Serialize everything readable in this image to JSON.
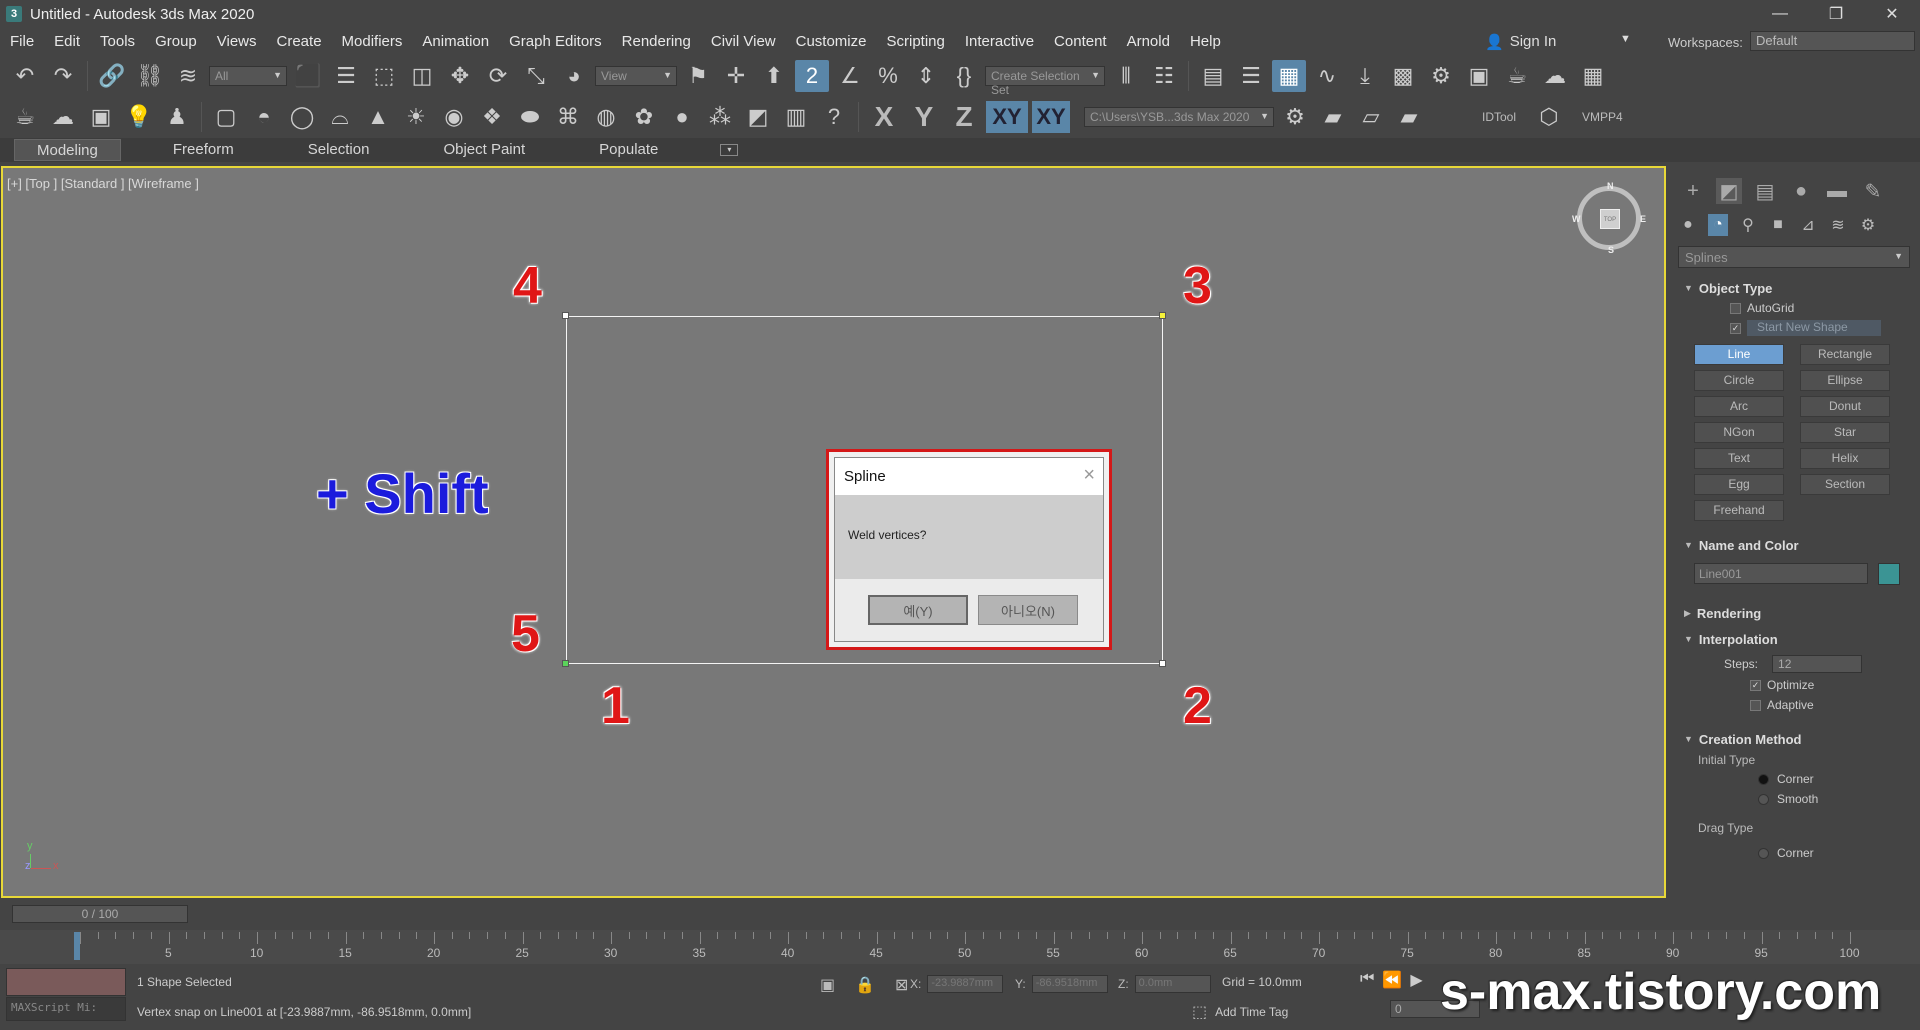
{
  "window": {
    "title": "Untitled - Autodesk 3ds Max 2020",
    "app_icon": "3"
  },
  "menu": [
    "File",
    "Edit",
    "Tools",
    "Group",
    "Views",
    "Create",
    "Modifiers",
    "Animation",
    "Graph Editors",
    "Rendering",
    "Civil View",
    "Customize",
    "Scripting",
    "Interactive",
    "Content",
    "Arnold",
    "Help"
  ],
  "account": {
    "sign_in": "Sign In",
    "workspaces_label": "Workspaces:",
    "workspace_value": "Default"
  },
  "toolbar1": {
    "filter_value": "All",
    "ref_coord_value": "View",
    "selection_set_placeholder": "Create Selection Set"
  },
  "toolbar2": {
    "axes": [
      "X",
      "Y",
      "Z",
      "XY",
      "XY"
    ],
    "project_path": "C:\\Users\\YSB...3ds Max 2020",
    "idtool": "IDTool",
    "vmpp": "VMPP4"
  },
  "ribbon_tabs": [
    "Modeling",
    "Freeform",
    "Selection",
    "Object Paint",
    "Populate"
  ],
  "viewport": {
    "label": "[+] [Top ] [Standard ] [Wireframe ]",
    "annotations": {
      "n1": "1",
      "n2": "2",
      "n3": "3",
      "n4": "4",
      "n5": "5",
      "shift": "+ Shift"
    },
    "viewcube": {
      "face": "TOP",
      "n": "N",
      "s": "S",
      "e": "E",
      "w": "W"
    },
    "axis_y": "y",
    "axis_x": "x",
    "axis_z": "z"
  },
  "dialog": {
    "title": "Spline",
    "message": "Weld vertices?",
    "yes_label": "예(Y)",
    "no_label": "아니오(N)"
  },
  "command_panel": {
    "category": "Splines",
    "object_type": {
      "header": "Object Type",
      "autogrid": "AutoGrid",
      "start_new_shape": "Start New Shape",
      "buttons": [
        "Line",
        "Rectangle",
        "Circle",
        "Ellipse",
        "Arc",
        "Donut",
        "NGon",
        "Star",
        "Text",
        "Helix",
        "Egg",
        "Section",
        "Freehand"
      ]
    },
    "name_and_color": {
      "header": "Name and Color",
      "name": "Line001",
      "color": "#3b9494"
    },
    "rendering_header": "Rendering",
    "interpolation": {
      "header": "Interpolation",
      "steps_label": "Steps:",
      "steps_value": "12",
      "optimize": "Optimize",
      "adaptive": "Adaptive"
    },
    "creation_method": {
      "header": "Creation Method",
      "initial_type": "Initial Type",
      "corner": "Corner",
      "smooth": "Smooth",
      "drag_type": "Drag Type",
      "drag_corner": "Corner"
    }
  },
  "timeline": {
    "frame_display": "0 / 100",
    "ticks": [
      "5",
      "10",
      "15",
      "20",
      "25",
      "30",
      "35",
      "40",
      "45",
      "50",
      "55",
      "60",
      "65",
      "70",
      "75",
      "80",
      "85",
      "90",
      "95",
      "100"
    ]
  },
  "status": {
    "selection": "1 Shape Selected",
    "prompt": "Vertex snap on Line001 at [-23.9887mm, -86.9518mm, 0.0mm]",
    "listener": "MAXScript Mi:",
    "x_label": "X:",
    "x_value": "-23.9887mm",
    "y_label": "Y:",
    "y_value": "-86.9518mm",
    "z_label": "Z:",
    "z_value": "0.0mm",
    "grid": "Grid = 10.0mm",
    "add_time_tag": "Add Time Tag",
    "frame": "0"
  },
  "watermark": "s-max.tistory.com"
}
